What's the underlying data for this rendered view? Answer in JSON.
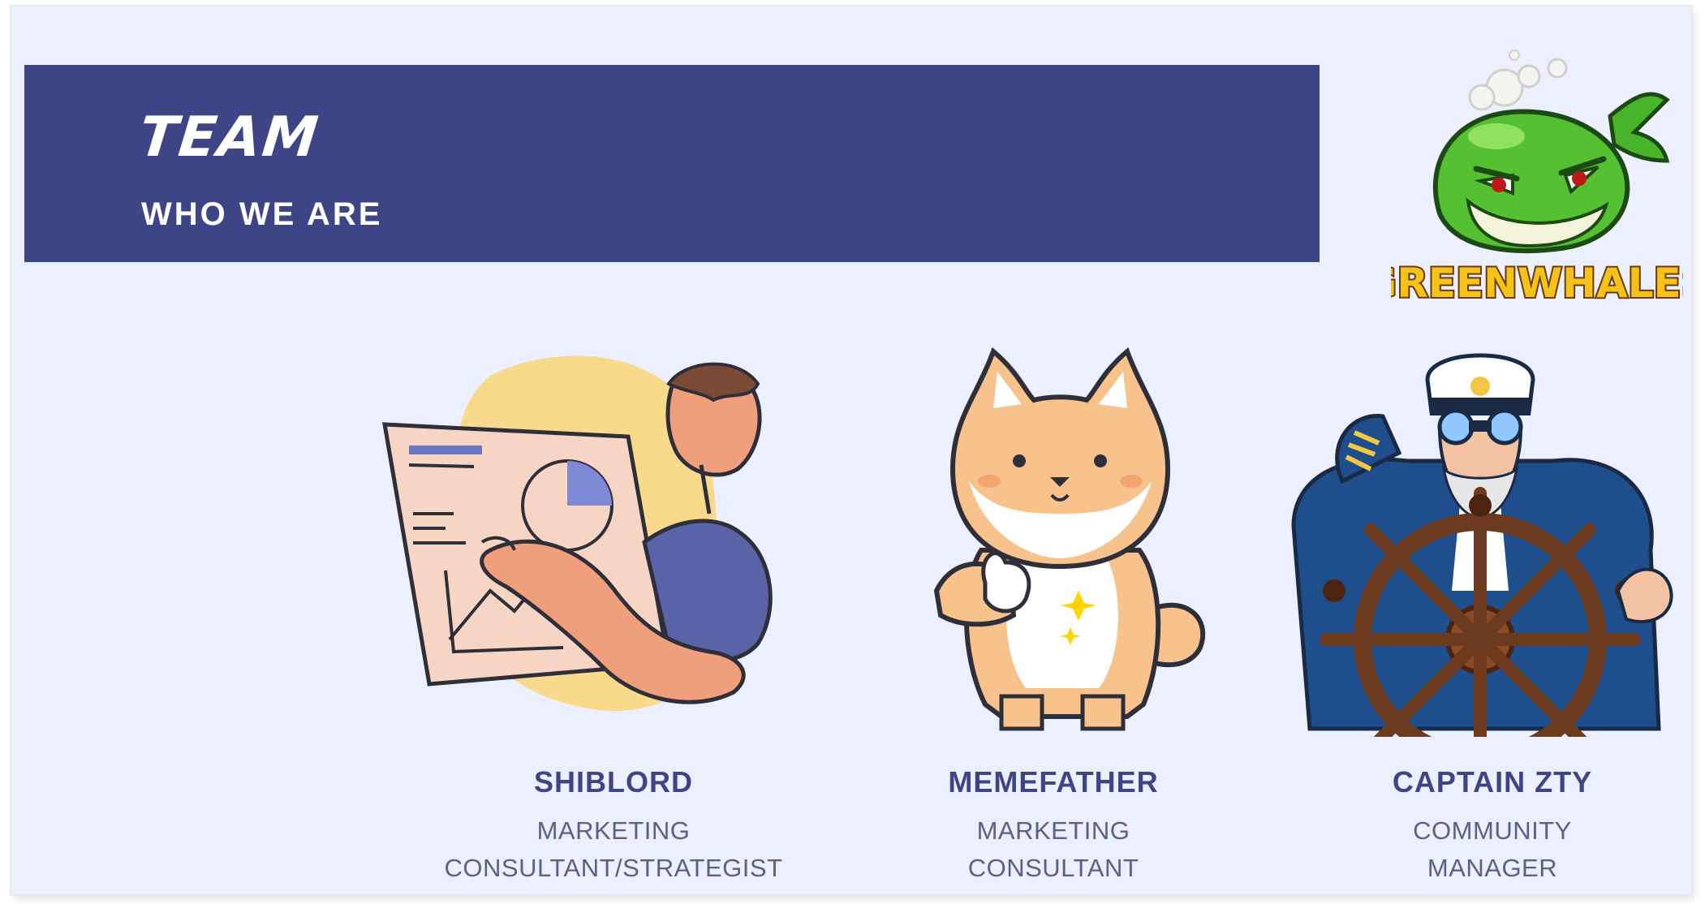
{
  "header": {
    "title": "TEAM",
    "subtitle": "WHO WE ARE"
  },
  "logo": {
    "text": "GREENWHALES",
    "icon": "green-whale-mascot-icon"
  },
  "colors": {
    "banner": "#3d4585",
    "background": "#eceffd",
    "name_text": "#3d4585",
    "role_text": "#5a6186"
  },
  "team": [
    {
      "name": "SHIBLORD",
      "role": "MARKETING\nCONSULTANT/STRATEGIST",
      "icon": "presenter-with-chart-icon"
    },
    {
      "name": "MEMEFATHER",
      "role": "MARKETING\nCONSULTANT",
      "icon": "shiba-dog-thumbs-up-icon"
    },
    {
      "name": "CAPTAIN ZTY",
      "role": "COMMUNITY\nMANAGER",
      "icon": "ship-captain-binoculars-icon"
    }
  ]
}
